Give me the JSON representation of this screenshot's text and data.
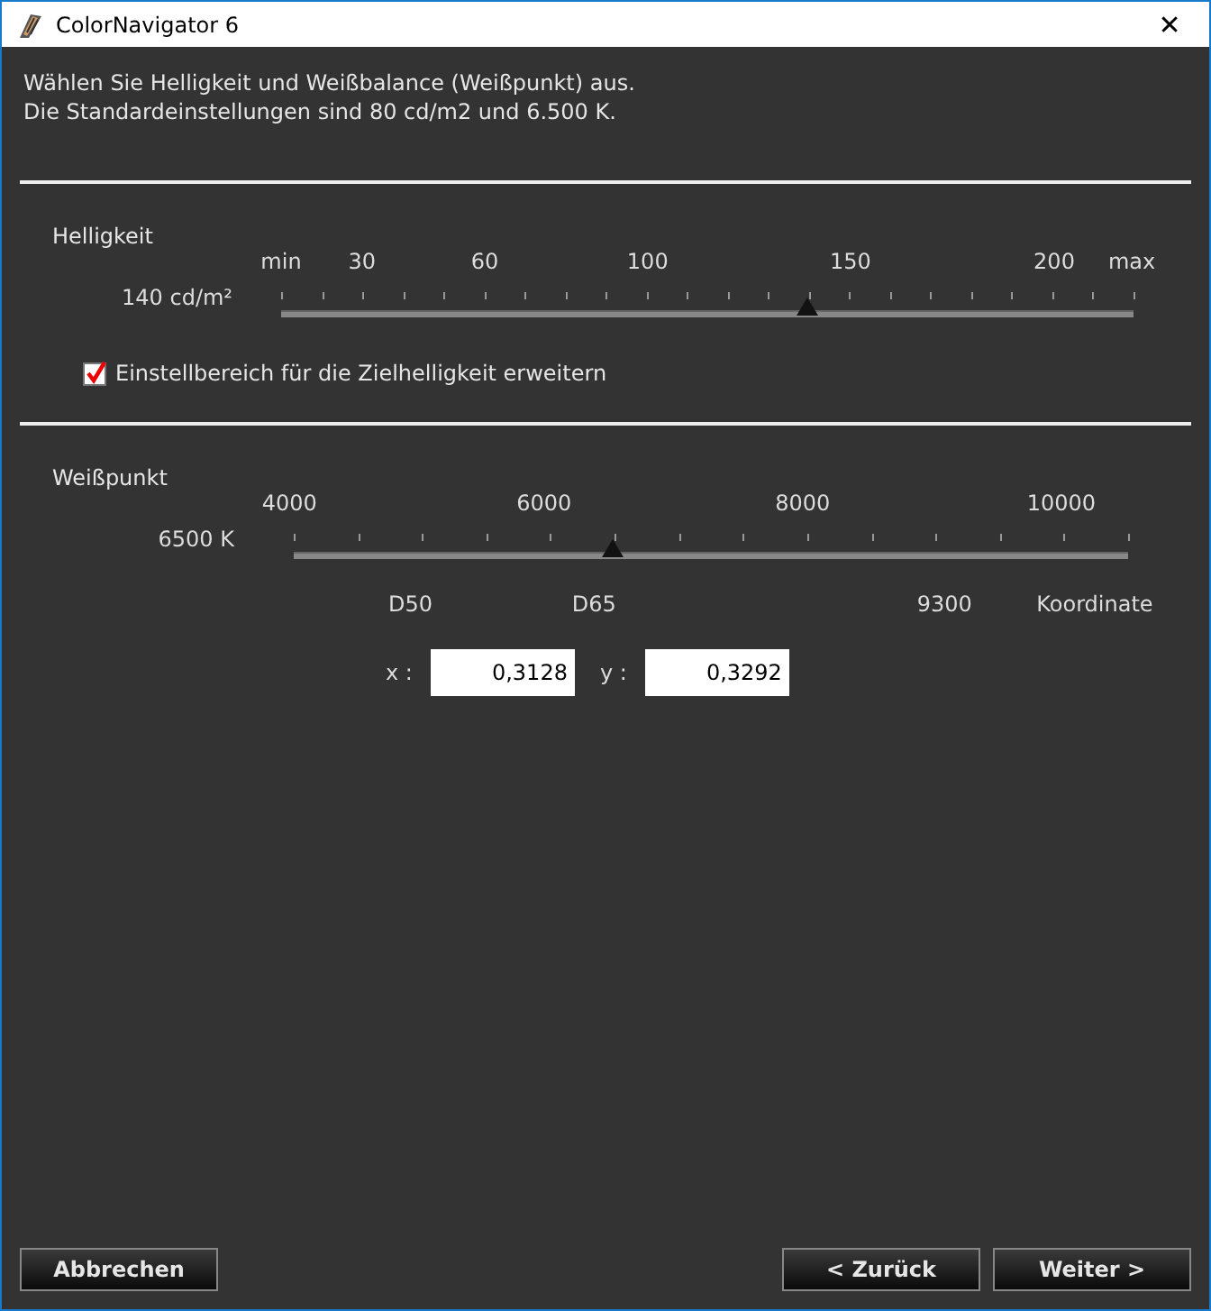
{
  "window": {
    "title": "ColorNavigator 6",
    "close": "✕"
  },
  "intro": [
    "Wählen Sie Helligkeit und Weißbalance (Weißpunkt) aus.",
    "Die Standardeinstellungen sind 80 cd/m2 und 6.500 K."
  ],
  "brightness": {
    "heading": "Helligkeit",
    "reading": "140 cd/m²",
    "level": 0.617,
    "scale_labels": [
      "min",
      "30",
      "60",
      "100",
      "150",
      "200",
      "max"
    ],
    "option": {
      "label": "Einstellbereich für die Zielhelligkeit erweitern",
      "checked": true
    }
  },
  "white_point": {
    "heading": "Weißpunkt",
    "reading": "6500 K",
    "level": 0.383,
    "scale_labels": [
      "4000",
      "6000",
      "8000",
      "10000"
    ],
    "presets": [
      "D50",
      "D65",
      "9300",
      "Koordinate"
    ],
    "coordinates": [
      {
        "label": "x :",
        "value": "0,3128"
      },
      {
        "label": "y :",
        "value": "0,3292"
      }
    ]
  },
  "buttons": {
    "cancel": "Abbrechen",
    "back": "< Zurück",
    "next": "Weiter >"
  }
}
